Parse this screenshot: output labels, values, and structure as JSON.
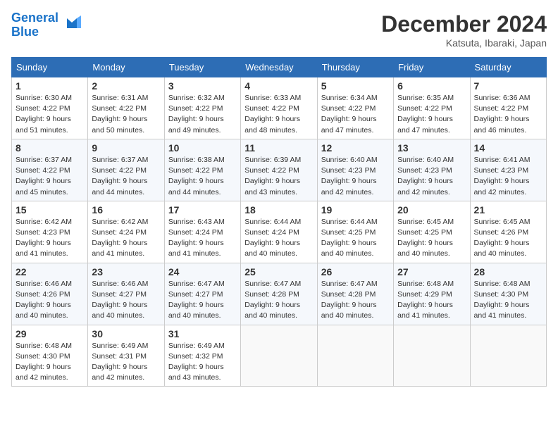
{
  "header": {
    "logo_line1": "General",
    "logo_line2": "Blue",
    "month": "December 2024",
    "location": "Katsuta, Ibaraki, Japan"
  },
  "weekdays": [
    "Sunday",
    "Monday",
    "Tuesday",
    "Wednesday",
    "Thursday",
    "Friday",
    "Saturday"
  ],
  "weeks": [
    [
      {
        "day": "1",
        "sunrise": "6:30 AM",
        "sunset": "4:22 PM",
        "daylight": "9 hours and 51 minutes."
      },
      {
        "day": "2",
        "sunrise": "6:31 AM",
        "sunset": "4:22 PM",
        "daylight": "9 hours and 50 minutes."
      },
      {
        "day": "3",
        "sunrise": "6:32 AM",
        "sunset": "4:22 PM",
        "daylight": "9 hours and 49 minutes."
      },
      {
        "day": "4",
        "sunrise": "6:33 AM",
        "sunset": "4:22 PM",
        "daylight": "9 hours and 48 minutes."
      },
      {
        "day": "5",
        "sunrise": "6:34 AM",
        "sunset": "4:22 PM",
        "daylight": "9 hours and 47 minutes."
      },
      {
        "day": "6",
        "sunrise": "6:35 AM",
        "sunset": "4:22 PM",
        "daylight": "9 hours and 47 minutes."
      },
      {
        "day": "7",
        "sunrise": "6:36 AM",
        "sunset": "4:22 PM",
        "daylight": "9 hours and 46 minutes."
      }
    ],
    [
      {
        "day": "8",
        "sunrise": "6:37 AM",
        "sunset": "4:22 PM",
        "daylight": "9 hours and 45 minutes."
      },
      {
        "day": "9",
        "sunrise": "6:37 AM",
        "sunset": "4:22 PM",
        "daylight": "9 hours and 44 minutes."
      },
      {
        "day": "10",
        "sunrise": "6:38 AM",
        "sunset": "4:22 PM",
        "daylight": "9 hours and 44 minutes."
      },
      {
        "day": "11",
        "sunrise": "6:39 AM",
        "sunset": "4:22 PM",
        "daylight": "9 hours and 43 minutes."
      },
      {
        "day": "12",
        "sunrise": "6:40 AM",
        "sunset": "4:23 PM",
        "daylight": "9 hours and 42 minutes."
      },
      {
        "day": "13",
        "sunrise": "6:40 AM",
        "sunset": "4:23 PM",
        "daylight": "9 hours and 42 minutes."
      },
      {
        "day": "14",
        "sunrise": "6:41 AM",
        "sunset": "4:23 PM",
        "daylight": "9 hours and 42 minutes."
      }
    ],
    [
      {
        "day": "15",
        "sunrise": "6:42 AM",
        "sunset": "4:23 PM",
        "daylight": "9 hours and 41 minutes."
      },
      {
        "day": "16",
        "sunrise": "6:42 AM",
        "sunset": "4:24 PM",
        "daylight": "9 hours and 41 minutes."
      },
      {
        "day": "17",
        "sunrise": "6:43 AM",
        "sunset": "4:24 PM",
        "daylight": "9 hours and 41 minutes."
      },
      {
        "day": "18",
        "sunrise": "6:44 AM",
        "sunset": "4:24 PM",
        "daylight": "9 hours and 40 minutes."
      },
      {
        "day": "19",
        "sunrise": "6:44 AM",
        "sunset": "4:25 PM",
        "daylight": "9 hours and 40 minutes."
      },
      {
        "day": "20",
        "sunrise": "6:45 AM",
        "sunset": "4:25 PM",
        "daylight": "9 hours and 40 minutes."
      },
      {
        "day": "21",
        "sunrise": "6:45 AM",
        "sunset": "4:26 PM",
        "daylight": "9 hours and 40 minutes."
      }
    ],
    [
      {
        "day": "22",
        "sunrise": "6:46 AM",
        "sunset": "4:26 PM",
        "daylight": "9 hours and 40 minutes."
      },
      {
        "day": "23",
        "sunrise": "6:46 AM",
        "sunset": "4:27 PM",
        "daylight": "9 hours and 40 minutes."
      },
      {
        "day": "24",
        "sunrise": "6:47 AM",
        "sunset": "4:27 PM",
        "daylight": "9 hours and 40 minutes."
      },
      {
        "day": "25",
        "sunrise": "6:47 AM",
        "sunset": "4:28 PM",
        "daylight": "9 hours and 40 minutes."
      },
      {
        "day": "26",
        "sunrise": "6:47 AM",
        "sunset": "4:28 PM",
        "daylight": "9 hours and 40 minutes."
      },
      {
        "day": "27",
        "sunrise": "6:48 AM",
        "sunset": "4:29 PM",
        "daylight": "9 hours and 41 minutes."
      },
      {
        "day": "28",
        "sunrise": "6:48 AM",
        "sunset": "4:30 PM",
        "daylight": "9 hours and 41 minutes."
      }
    ],
    [
      {
        "day": "29",
        "sunrise": "6:48 AM",
        "sunset": "4:30 PM",
        "daylight": "9 hours and 42 minutes."
      },
      {
        "day": "30",
        "sunrise": "6:49 AM",
        "sunset": "4:31 PM",
        "daylight": "9 hours and 42 minutes."
      },
      {
        "day": "31",
        "sunrise": "6:49 AM",
        "sunset": "4:32 PM",
        "daylight": "9 hours and 43 minutes."
      },
      null,
      null,
      null,
      null
    ]
  ],
  "labels": {
    "sunrise": "Sunrise:",
    "sunset": "Sunset:",
    "daylight": "Daylight:"
  }
}
